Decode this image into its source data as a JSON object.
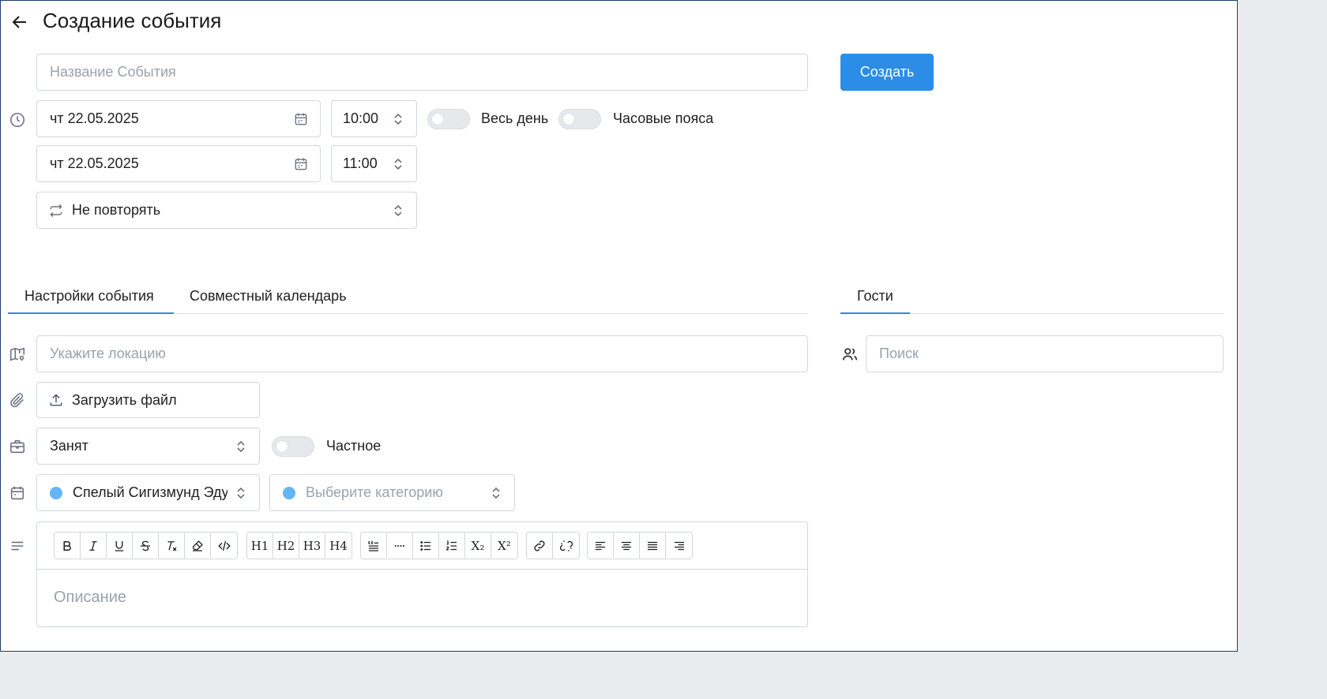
{
  "header": {
    "title": "Создание события"
  },
  "form": {
    "event_name_placeholder": "Название События",
    "create_button": "Создать",
    "start_date": "чт 22.05.2025",
    "start_time": "10:00",
    "end_date": "чт 22.05.2025",
    "end_time": "11:00",
    "all_day_label": "Весь день",
    "timezones_label": "Часовые пояса",
    "repeat_value": "Не повторять"
  },
  "tabs": {
    "event_settings": "Настройки события",
    "shared_calendar": "Совместный календарь",
    "guests": "Гости"
  },
  "settings": {
    "location_placeholder": "Укажите локацию",
    "upload_label": "Загрузить файл",
    "busy_value": "Занят",
    "private_label": "Частное",
    "calendar_value": "Спелый Сигизмунд Эдуардович",
    "category_placeholder": "Выберите категорию",
    "description_placeholder": "Описание"
  },
  "guests": {
    "search_placeholder": "Поиск"
  },
  "toolbar": {
    "h1": "H1",
    "h2": "H2",
    "h3": "H3",
    "h4": "H4",
    "subscript": "X₂",
    "superscript": "X²"
  },
  "colors": {
    "accent": "#2b8de6",
    "calendar_dot": "#64b5f6",
    "category_dot": "#64b5f6"
  },
  "icons": [
    "arrow-left-icon",
    "clock-icon",
    "calendar-icon",
    "chevron-updown-icon",
    "repeat-icon",
    "map-pin-icon",
    "paperclip-icon",
    "upload-icon",
    "briefcase-icon",
    "calendar-small-icon",
    "align-left-icon",
    "users-icon",
    "bold-icon",
    "italic-icon",
    "underline-icon",
    "strikethrough-icon",
    "clear-format-icon",
    "highlighter-icon",
    "code-icon",
    "blockquote-icon",
    "horizontal-rule-icon",
    "bullet-list-icon",
    "ordered-list-icon",
    "link-icon",
    "unlink-icon",
    "align-left-text-icon",
    "align-center-icon",
    "align-justify-icon",
    "align-right-icon"
  ]
}
